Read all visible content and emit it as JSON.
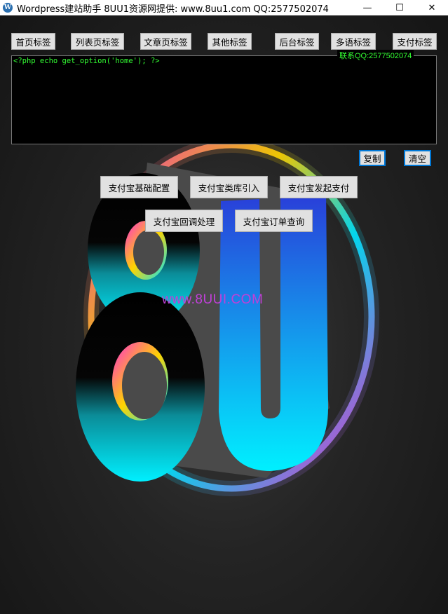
{
  "window": {
    "title": "Wordpress建站助手 8UU1资源网提供: www.8uu1.com QQ:2577502074",
    "app_icon": "wordpress-icon",
    "controls": {
      "minimize": "—",
      "maximize": "☐",
      "close": "✕"
    }
  },
  "tabs": [
    "首页标签",
    "列表页标签",
    "文章页标签",
    "其他标签",
    "后台标签",
    "多语标签",
    "支付标签"
  ],
  "editor": {
    "content": "<?php echo get_option('home'); ?>",
    "contact_label": "联系QQ:2577502074",
    "text_color": "#33ff33"
  },
  "actions": {
    "copy": "复制",
    "clear": "清空"
  },
  "payment_buttons": {
    "basic_config": "支付宝基础配置",
    "lib_import": "支付宝类库引入",
    "initiate": "支付宝发起支付",
    "callback": "支付宝回调处理",
    "order_query": "支付宝订单查询"
  },
  "background": {
    "logo_text": "8U",
    "watermark": "www.8UUI.COM",
    "accent_colors": [
      "#ff2bd6",
      "#ffd400",
      "#00e5ff",
      "#2a3bd8"
    ]
  }
}
